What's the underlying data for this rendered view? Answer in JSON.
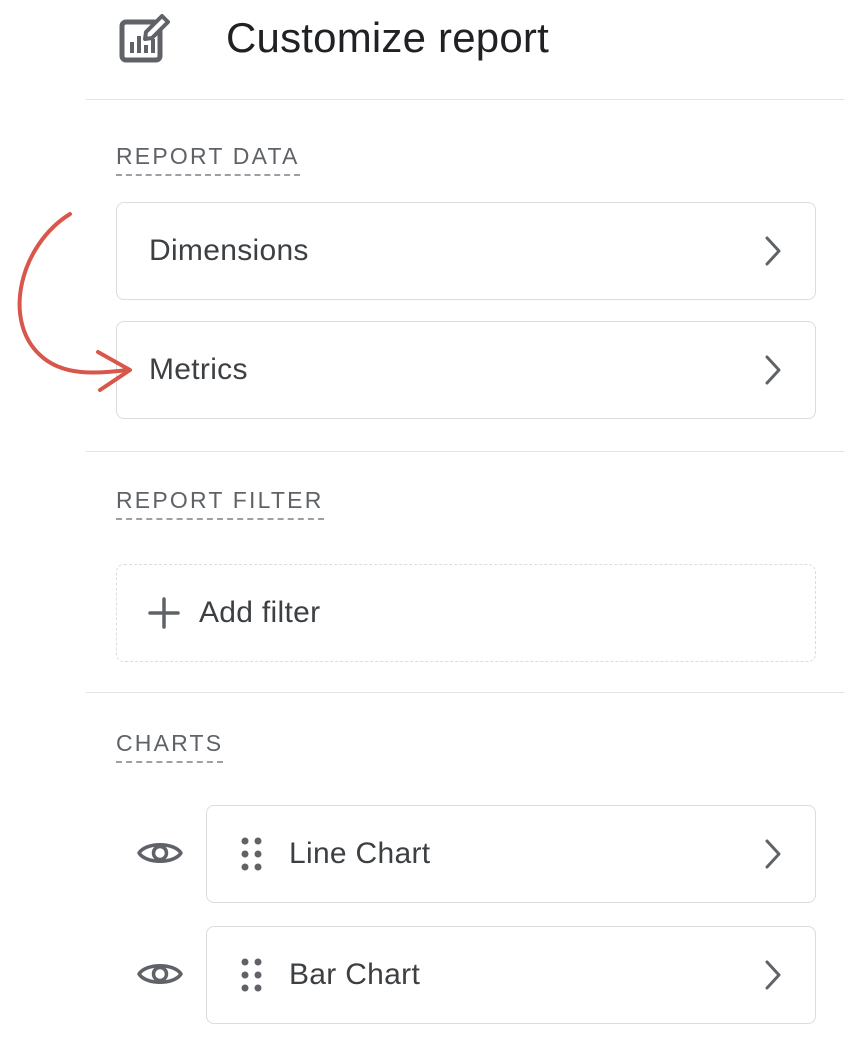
{
  "header": {
    "title": "Customize report",
    "icon": "report-edit-icon"
  },
  "report_data": {
    "label": "REPORT DATA",
    "items": [
      {
        "label": "Dimensions",
        "icon": "chevron-right-icon"
      },
      {
        "label": "Metrics",
        "icon": "chevron-right-icon"
      }
    ]
  },
  "report_filter": {
    "label": "REPORT FILTER",
    "add_filter_label": "Add filter",
    "icon": "plus-icon"
  },
  "charts": {
    "label": "CHARTS",
    "items": [
      {
        "label": "Line Chart",
        "visibility_icon": "eye-icon",
        "handle_icon": "drag-handle-icon"
      },
      {
        "label": "Bar Chart",
        "visibility_icon": "eye-icon",
        "handle_icon": "drag-handle-icon"
      }
    ]
  },
  "annotation": {
    "icon": "curved-arrow-icon",
    "color": "#d9574a"
  },
  "colors": {
    "text": "#3c4043",
    "section_label": "#5f6368",
    "border": "#dadce0",
    "divider": "#e3e3e3"
  }
}
